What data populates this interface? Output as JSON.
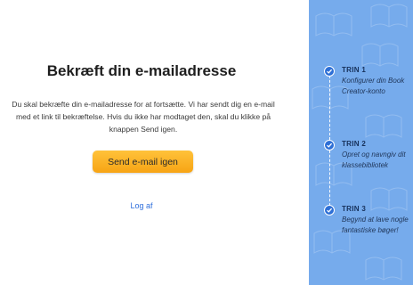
{
  "main": {
    "title": "Bekræft din e-mailadresse",
    "description": "Du skal bekræfte din e-mailadresse for at fortsætte. Vi har sendt dig en e-mail med et link til bekræftelse. Hvis du ikke har modtaget den, skal du klikke på knappen Send igen.",
    "send_button_label": "Send e-mail igen",
    "logout_label": "Log af",
    "accent_color": "#f7a414",
    "link_color": "#2f6fdc"
  },
  "steps_panel": {
    "background_color": "#76abec",
    "steps": [
      {
        "label": "TRIN 1",
        "text": "Konfigurer din Book Creator-konto",
        "icon": "check-icon"
      },
      {
        "label": "TRIN 2",
        "text": "Opret og navngiv dit klassebibliotek",
        "icon": "check-icon"
      },
      {
        "label": "TRIN 3",
        "text": "Begynd at lave nogle fantastiske bøger!",
        "icon": "check-icon"
      }
    ]
  }
}
